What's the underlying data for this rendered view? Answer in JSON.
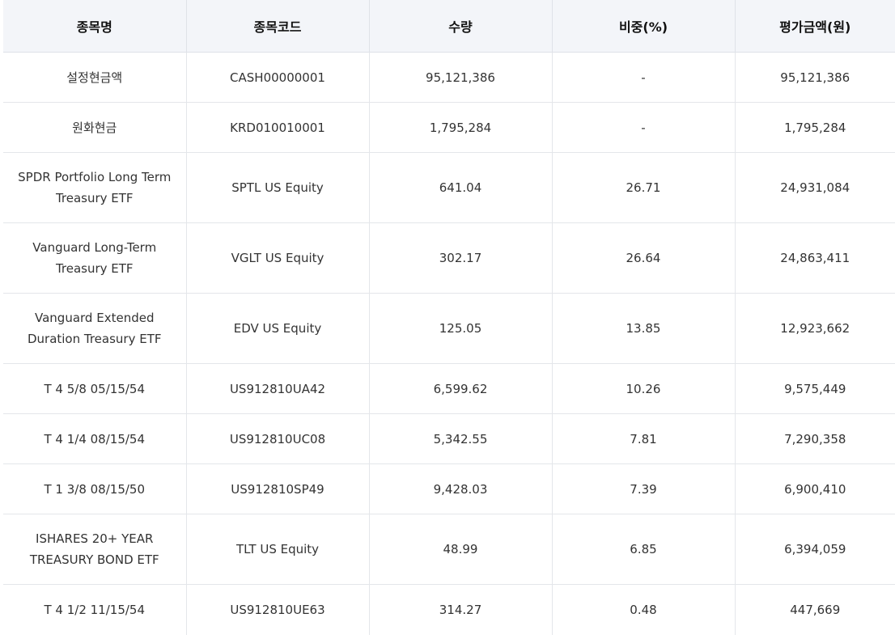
{
  "table": {
    "headers": [
      "종목명",
      "종목코드",
      "수량",
      "비중(%)",
      "평가금액(원)"
    ],
    "rows": [
      {
        "name": "설정현금액",
        "code": "CASH00000001",
        "qty": "95,121,386",
        "weight": "-",
        "value": "95,121,386"
      },
      {
        "name": "원화현금",
        "code": "KRD010010001",
        "qty": "1,795,284",
        "weight": "-",
        "value": "1,795,284"
      },
      {
        "name": "SPDR Portfolio Long Term Treasury ETF",
        "code": "SPTL US Equity",
        "qty": "641.04",
        "weight": "26.71",
        "value": "24,931,084"
      },
      {
        "name": "Vanguard Long-Term Treasury ETF",
        "code": "VGLT US Equity",
        "qty": "302.17",
        "weight": "26.64",
        "value": "24,863,411"
      },
      {
        "name": "Vanguard Extended Duration Treasury ETF",
        "code": "EDV US Equity",
        "qty": "125.05",
        "weight": "13.85",
        "value": "12,923,662"
      },
      {
        "name": "T 4 5/8 05/15/54",
        "code": "US912810UA42",
        "qty": "6,599.62",
        "weight": "10.26",
        "value": "9,575,449"
      },
      {
        "name": "T 4 1/4 08/15/54",
        "code": "US912810UC08",
        "qty": "5,342.55",
        "weight": "7.81",
        "value": "7,290,358"
      },
      {
        "name": "T 1 3/8 08/15/50",
        "code": "US912810SP49",
        "qty": "9,428.03",
        "weight": "7.39",
        "value": "6,900,410"
      },
      {
        "name": "ISHARES 20+ YEAR TREASURY BOND ETF",
        "code": "TLT US Equity",
        "qty": "48.99",
        "weight": "6.85",
        "value": "6,394,059"
      },
      {
        "name": "T 4 1/2 11/15/54",
        "code": "US912810UE63",
        "qty": "314.27",
        "weight": "0.48",
        "value": "447,669"
      }
    ]
  }
}
